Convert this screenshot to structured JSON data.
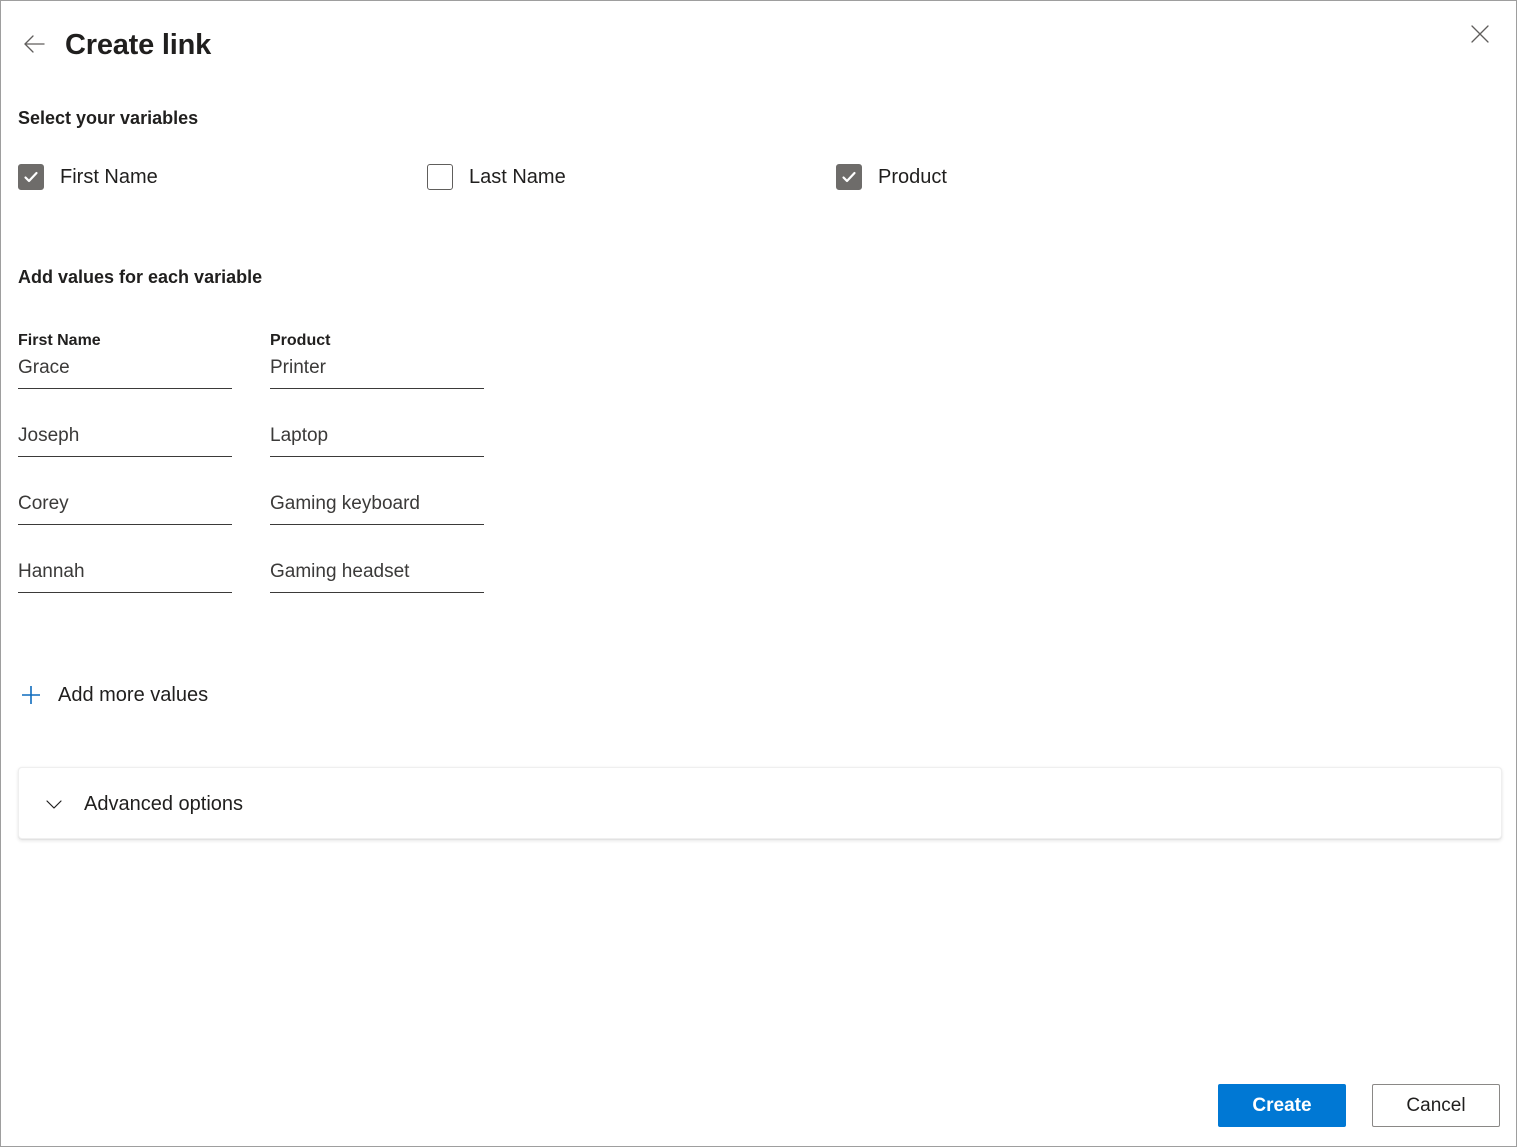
{
  "header": {
    "title": "Create link",
    "back_icon": "arrow-left-icon",
    "close_icon": "close-icon"
  },
  "variables_section": {
    "heading": "Select your variables",
    "checkboxes": [
      {
        "label": "First Name",
        "checked": true
      },
      {
        "label": "Last Name",
        "checked": false
      },
      {
        "label": "Product",
        "checked": true
      }
    ]
  },
  "values_section": {
    "heading": "Add values for each variable",
    "columns": [
      {
        "header": "First Name",
        "values": [
          "Grace",
          "Joseph",
          "Corey",
          "Hannah"
        ]
      },
      {
        "header": "Product",
        "values": [
          "Printer",
          "Laptop",
          "Gaming keyboard",
          "Gaming headset"
        ]
      }
    ],
    "add_more": {
      "label": "Add more values",
      "icon": "plus-icon",
      "icon_color": "#0f6cbd"
    }
  },
  "advanced": {
    "label": "Advanced options",
    "icon": "chevron-down-icon",
    "expanded": false
  },
  "footer": {
    "primary_label": "Create",
    "secondary_label": "Cancel"
  },
  "colors": {
    "accent": "#0078d4",
    "link": "#0f6cbd",
    "text": "#201f1e",
    "checkbox_fill": "#6e6c6a",
    "field_underline": "#3b3a39"
  }
}
